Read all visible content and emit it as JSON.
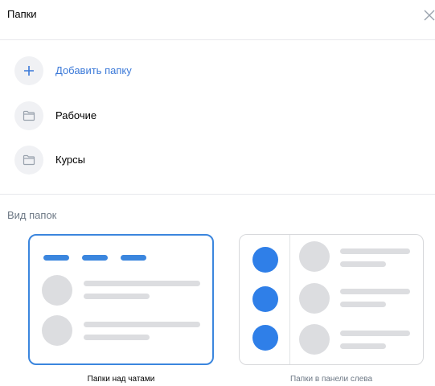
{
  "header": {
    "title": "Папки"
  },
  "folders": {
    "add_label": "Добавить папку",
    "items": [
      {
        "label": "Рабочие"
      },
      {
        "label": "Курсы"
      }
    ]
  },
  "view": {
    "section_title": "Вид папок",
    "options": [
      {
        "label": "Папки над чатами",
        "selected": true
      },
      {
        "label": "Папки в панели слева",
        "selected": false
      }
    ]
  },
  "colors": {
    "accent": "#3b86de",
    "link": "#3b79d8",
    "placeholder": "#dcdde0"
  }
}
